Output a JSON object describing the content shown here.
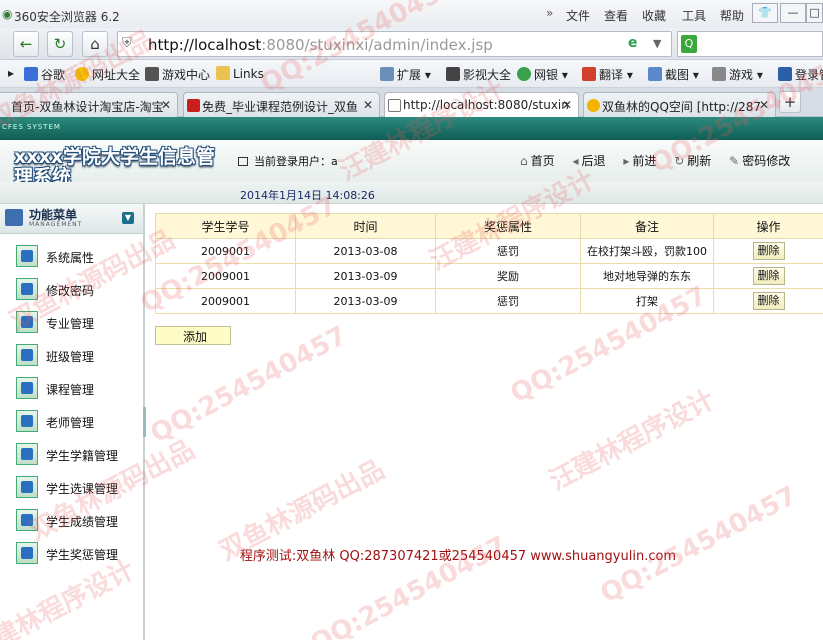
{
  "browser": {
    "app_title": "360安全浏览器 6.2",
    "menu": [
      "文件",
      "查看",
      "收藏",
      "工具",
      "帮助"
    ],
    "url_host": "http://localhost",
    "url_rest": ":8080/stuxinxi/admin/index.jsp",
    "favorites": [
      "谷歌",
      "网址大全",
      "游戏中心",
      "Links",
      "扩展",
      "影视大全",
      "网银",
      "翻译",
      "截图",
      "游戏",
      "登录管"
    ],
    "tabs": [
      {
        "label": "首页-双鱼林设计淘宝店-淘宝"
      },
      {
        "label": "免费_毕业课程范例设计_双鱼"
      },
      {
        "label": "http://localhost:8080/stuxin"
      },
      {
        "label": "双鱼林的QQ空间 [http://287"
      }
    ]
  },
  "app": {
    "logo_small": "CFES SYSTEM",
    "system_title": "xxxx学院大学生信息管理系统",
    "current_user_label": "当前登录用户：a",
    "datetime": "2014年1月14日   14:08:26",
    "nav_links": [
      "首页",
      "后退",
      "前进",
      "刷新",
      "密码修改"
    ]
  },
  "menu": {
    "title": "功能菜单",
    "subtitle": "MANAGEMENT",
    "items": [
      "系统属性",
      "修改密码",
      "专业管理",
      "班级管理",
      "课程管理",
      "老师管理",
      "学生学籍管理",
      "学生选课管理",
      "学生成绩管理",
      "学生奖惩管理"
    ]
  },
  "table": {
    "headers": [
      "学生学号",
      "时间",
      "奖惩属性",
      "备注",
      "操作"
    ],
    "rows": [
      {
        "id": "2009001",
        "date": "2013-03-08",
        "type": "惩罚",
        "note": "在校打架斗殴，罚款100",
        "action": "删除"
      },
      {
        "id": "2009001",
        "date": "2013-03-09",
        "type": "奖励",
        "note": "地对地导弹的东东",
        "action": "删除"
      },
      {
        "id": "2009001",
        "date": "2013-03-09",
        "type": "惩罚",
        "note": "打架",
        "action": "删除"
      }
    ],
    "add_label": "添加"
  },
  "footer": "程序测试:双鱼林 QQ:287307421或254540457 www.shuangyulin.com",
  "watermarks": [
    "双鱼林源码出品",
    "汪建林程序设计",
    "QQ:254540457",
    "QQ:254540457",
    "双鱼林源码出品",
    "QQ:254540457",
    "汪建林程序设计",
    "QQ:254540457",
    "双鱼林源码出品",
    "汪建林程序设计",
    "QQ:254540457",
    "QQ:254540457",
    "汪建林程序设计",
    "双鱼林源码出品",
    "QQ:254540457"
  ],
  "colors": {
    "header_teal": "#0f5e55",
    "table_header_bg": "#fff7d6",
    "footer_red": "#a01010"
  }
}
